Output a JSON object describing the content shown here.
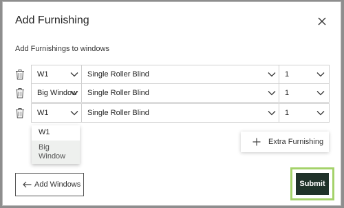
{
  "dialog": {
    "title": "Add Furnishing",
    "subtitle": "Add Furnishings to windows"
  },
  "rows": [
    {
      "window": "W1",
      "furnishing": "Single Roller Blind",
      "quantity": "1"
    },
    {
      "window": "Big Window",
      "furnishing": "Single Roller Blind",
      "quantity": "1"
    },
    {
      "window": "W1",
      "furnishing": "Single Roller Blind",
      "quantity": "1"
    }
  ],
  "dropdown": {
    "options": [
      "W1",
      "Big Window"
    ]
  },
  "buttons": {
    "extra_furnishing": "Extra Furnishing",
    "add_windows": "Add Windows",
    "submit": "Submit"
  },
  "colors": {
    "submit_bg": "#1f3229",
    "highlight_ring": "#a4d26a",
    "overlay": "#8e8e8e"
  },
  "icons": [
    "close-icon",
    "trash-icon",
    "chevron-down-icon",
    "plus-icon",
    "arrow-left-icon"
  ]
}
